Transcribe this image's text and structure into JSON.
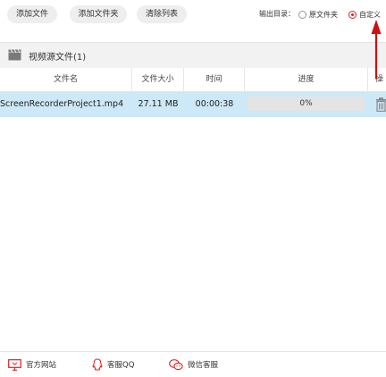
{
  "toolbar": {
    "add_file": "添加文件",
    "add_folder": "添加文件夹",
    "clear_list": "清除列表",
    "output_label": "输出目录：",
    "output_options": [
      "原文件夹",
      "自定义"
    ],
    "selected_output": "自定义"
  },
  "group": {
    "title": "视频源文件(1)"
  },
  "table": {
    "columns": [
      "文件名",
      "文件大小",
      "时间",
      "进度",
      "操"
    ],
    "rows": [
      {
        "name": "ScreenRecorderProject1.mp4",
        "size": "27.11 MB",
        "time": "00:00:38",
        "progress": "0%"
      }
    ]
  },
  "footer": {
    "website": "官方网站",
    "qq": "客服QQ",
    "wechat": "微信客服"
  },
  "colors": {
    "accent": "#e02020",
    "row_selected": "#cde8f6"
  }
}
